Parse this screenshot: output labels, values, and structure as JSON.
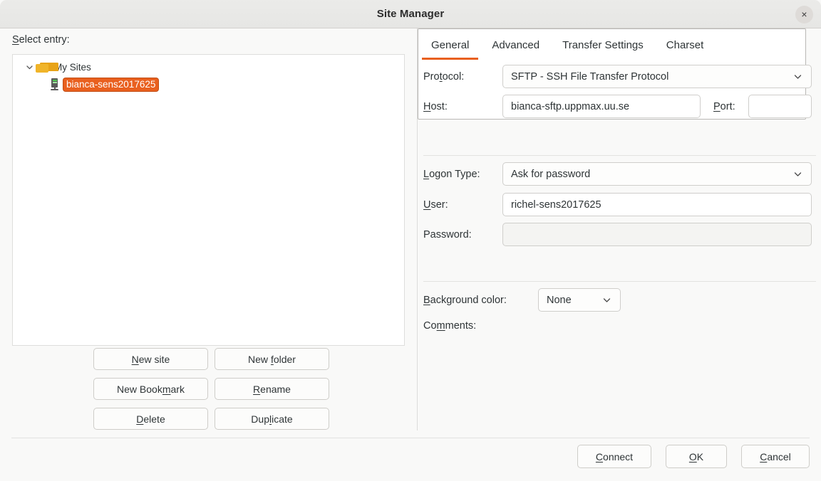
{
  "window": {
    "title": "Site Manager",
    "close_icon": "close-icon",
    "close_glyph": "×"
  },
  "left": {
    "select_entry_label_pre": "S",
    "select_entry_label_post": "elect entry:",
    "tree": {
      "root": {
        "label": "My Sites",
        "icon": "folder-icon",
        "expanded": true,
        "twisty_glyph": "⌄"
      },
      "children": [
        {
          "label": "bianca-sens2017625",
          "icon": "server-icon",
          "selected": true
        }
      ]
    },
    "buttons": [
      {
        "name": "new-site-button",
        "pre": "",
        "acc": "N",
        "post": "ew site"
      },
      {
        "name": "new-folder-button",
        "pre": "New ",
        "acc": "f",
        "post": "older"
      },
      {
        "name": "new-bookmark-button",
        "pre": "New Book",
        "acc": "m",
        "post": "ark"
      },
      {
        "name": "rename-button",
        "pre": "",
        "acc": "R",
        "post": "ename"
      },
      {
        "name": "delete-button",
        "pre": "",
        "acc": "D",
        "post": "elete"
      },
      {
        "name": "duplicate-button",
        "pre": "Dup",
        "acc": "l",
        "post": "icate"
      }
    ]
  },
  "right": {
    "tabs": [
      {
        "label": "General",
        "active": true
      },
      {
        "label": "Advanced",
        "active": false
      },
      {
        "label": "Transfer Settings",
        "active": false
      },
      {
        "label": "Charset",
        "active": false
      }
    ],
    "fields": {
      "protocol": {
        "label_pre": "Pro",
        "label_acc": "t",
        "label_post": "ocol:",
        "value": "SFTP - SSH File Transfer Protocol",
        "chevron": "chevron-down-icon"
      },
      "host": {
        "label_pre": "",
        "label_acc": "H",
        "label_post": "ost:",
        "value": "bianca-sftp.uppmax.uu.se",
        "placeholder": ""
      },
      "port": {
        "label_pre": "",
        "label_acc": "P",
        "label_post": "ort:",
        "value": "",
        "placeholder": ""
      },
      "logon_type": {
        "label_pre": "",
        "label_acc": "L",
        "label_post": "ogon Type:",
        "value": "Ask for password",
        "chevron": "chevron-down-icon"
      },
      "user": {
        "label_pre": "",
        "label_acc": "U",
        "label_post": "ser:",
        "value": "richel-sens2017625",
        "placeholder": ""
      },
      "password": {
        "label_pre": "Password:",
        "label_acc": "",
        "label_post": "",
        "value": "",
        "placeholder": "",
        "disabled": true
      },
      "background_color": {
        "label_pre": "",
        "label_acc": "B",
        "label_post": "ackground color:",
        "value": "None",
        "chevron": "chevron-down-icon"
      },
      "comments": {
        "label_pre": "Co",
        "label_acc": "m",
        "label_post": "ments:",
        "value": ""
      }
    }
  },
  "footer": {
    "buttons": [
      {
        "name": "connect-button",
        "pre": "",
        "acc": "C",
        "post": "onnect"
      },
      {
        "name": "ok-button",
        "pre": "",
        "acc": "O",
        "post": "K"
      },
      {
        "name": "cancel-button",
        "pre": "",
        "acc": "C",
        "post": "ancel"
      }
    ]
  },
  "colors": {
    "accent": "#e8601f",
    "selection": "#e9601f",
    "dialog_bg": "#f9f9f8",
    "field_bg": "#ffffff",
    "border": "#cfcecb"
  }
}
